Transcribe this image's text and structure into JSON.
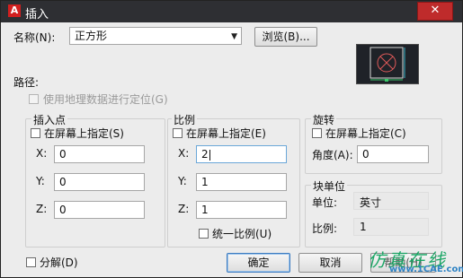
{
  "window": {
    "title": "插入",
    "app_icon_letter": "A",
    "close_glyph": "✕"
  },
  "name_row": {
    "label": "名称(N):",
    "value": "正方形",
    "browse_label": "浏览(B)..."
  },
  "path": {
    "label": "路径:"
  },
  "geo": {
    "label": "使用地理数据进行定位(G)",
    "checked": false,
    "enabled": false
  },
  "insertion": {
    "title": "插入点",
    "specify_label": "在屏幕上指定(S)",
    "x_label": "X:",
    "x_value": "0",
    "y_label": "Y:",
    "y_value": "0",
    "z_label": "Z:",
    "z_value": "0"
  },
  "scale": {
    "title": "比例",
    "specify_label": "在屏幕上指定(E)",
    "x_label": "X:",
    "x_value": "2",
    "y_label": "Y:",
    "y_value": "1",
    "z_label": "Z:",
    "z_value": "1",
    "uniform_label": "统一比例(U)"
  },
  "rotation": {
    "title": "旋转",
    "specify_label": "在屏幕上指定(C)",
    "angle_label": "角度(A):",
    "angle_value": "0"
  },
  "block_unit": {
    "title": "块单位",
    "unit_label": "单位:",
    "unit_value": "英寸",
    "ratio_label": "比例:",
    "ratio_value": "1"
  },
  "explode": {
    "label": "分解(D)",
    "checked": false
  },
  "buttons": {
    "ok_label": "确定",
    "cancel_label": "取消",
    "help_label": "帮助(H)"
  },
  "watermark": {
    "text": "仿真在线",
    "subtext": "www.1CAE.com"
  },
  "colors": {
    "titlebar": "#2e2f33",
    "close_button": "#bf2b2b",
    "watermark_green": "#11a35f",
    "watermark_blue": "#2f83c4",
    "preview_bg": "#1f2228"
  }
}
